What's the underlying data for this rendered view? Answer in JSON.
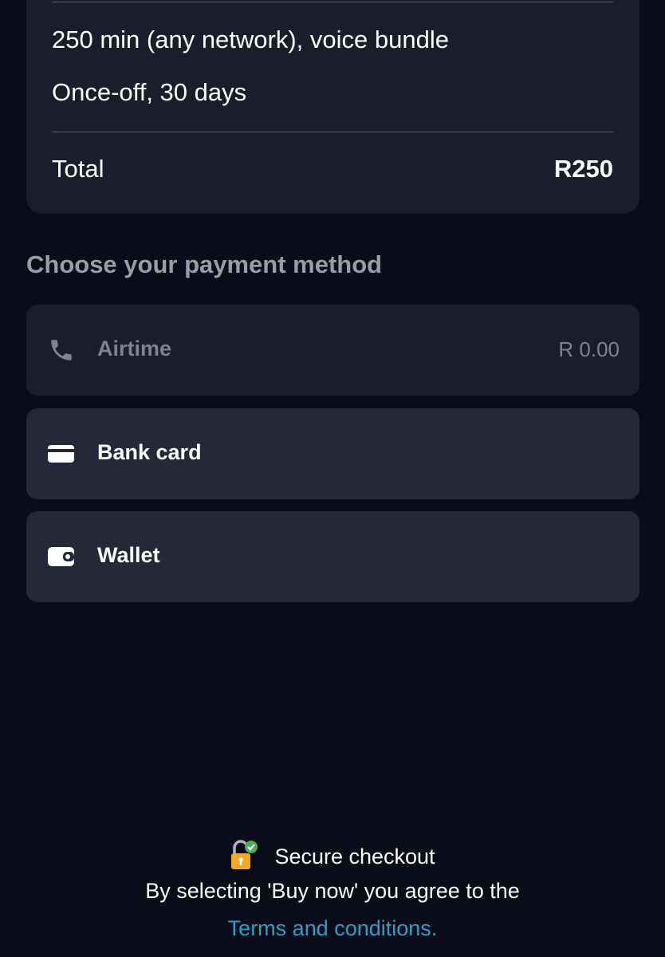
{
  "summary": {
    "bundle_name": "250 min (any network), voice bundle",
    "bundle_term": "Once-off, 30 days",
    "total_label": "Total",
    "total_value": "R250"
  },
  "payment": {
    "section_title": "Choose your payment method",
    "options": [
      {
        "label": "Airtime",
        "amount": "R 0.00",
        "icon": "phone-icon",
        "enabled": false
      },
      {
        "label": "Bank card",
        "amount": "",
        "icon": "credit-card-icon",
        "enabled": true
      },
      {
        "label": "Wallet",
        "amount": "",
        "icon": "wallet-icon",
        "enabled": true
      }
    ]
  },
  "footer": {
    "secure_label": "Secure checkout",
    "agreement_text": "By selecting 'Buy now' you agree to the",
    "terms_link": "Terms and conditions."
  },
  "colors": {
    "background": "#0a0c1a",
    "card": "#1a1d2c",
    "option": "#242838",
    "muted_text": "#9a9ca6",
    "link": "#2a9fc8",
    "lock_orange": "#f5a623",
    "check_green": "#4caf50"
  }
}
